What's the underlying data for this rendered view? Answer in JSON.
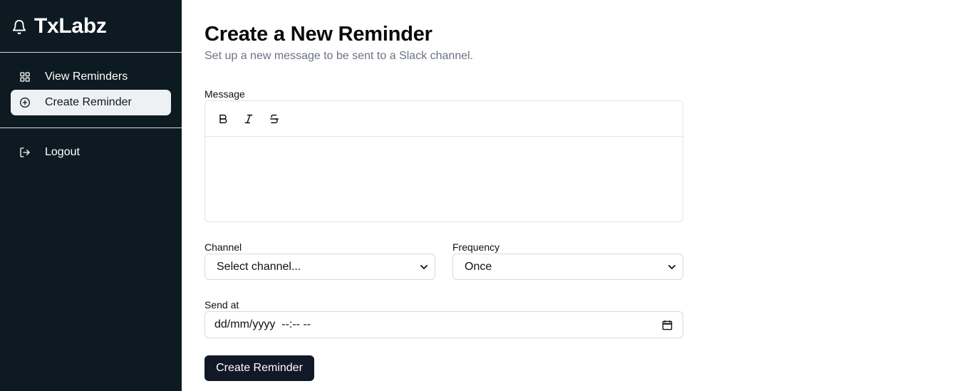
{
  "app": {
    "name": "TxLabz"
  },
  "sidebar": {
    "items": [
      {
        "label": "View Reminders"
      },
      {
        "label": "Create Reminder"
      }
    ],
    "logout": "Logout"
  },
  "page": {
    "title": "Create a New Reminder",
    "subtitle": "Set up a new message to be sent to a Slack channel."
  },
  "form": {
    "message_label": "Message",
    "toolbar": {
      "bold": "B",
      "italic": "I",
      "strike": "S"
    },
    "channel_label": "Channel",
    "channel_value": "Select channel...",
    "frequency_label": "Frequency",
    "frequency_value": "Once",
    "send_at_label": "Send at",
    "send_at_value": "dd/mm/yyyy  --:-- --",
    "submit_label": "Create Reminder"
  },
  "icons": {
    "brand": "bell-icon",
    "view": "grid-icon",
    "create": "plus-circle-icon",
    "logout": "logout-icon",
    "calendar": "calendar-icon",
    "chevron": "chevron-down-icon"
  },
  "colors": {
    "sidebar_bg": "#0e1a22",
    "active_bg": "#eef1f4",
    "primary_button": "#111827",
    "subtitle": "#6b7280"
  }
}
